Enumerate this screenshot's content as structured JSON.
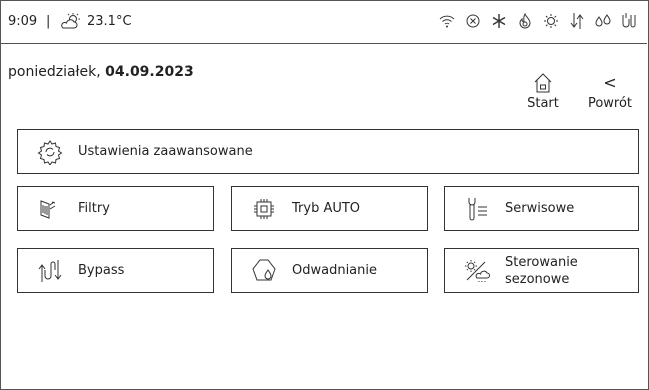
{
  "status": {
    "time": "9:09",
    "separator": "|",
    "temperature": "23.1°C",
    "icons": [
      "wifi-icon",
      "cancel-circle-icon",
      "snowflake-icon",
      "flame-icon",
      "sun-alert-icon",
      "airflow-icon",
      "drops-icon",
      "humidity-icon"
    ]
  },
  "date": {
    "weekday": "poniedziałek,",
    "date": "04.09.2023"
  },
  "nav": {
    "start": "Start",
    "back": "Powrót",
    "back_glyph": "<"
  },
  "buttons": {
    "advanced": "Ustawienia zaawansowane",
    "filters": "Filtry",
    "auto": "Tryb AUTO",
    "service": "Serwisowe",
    "bypass": "Bypass",
    "drainage": "Odwadnianie",
    "seasonal_1": "Sterowanie",
    "seasonal_2": "sezonowe"
  },
  "colors": {
    "border": "#333333",
    "text": "#222222",
    "background": "#ffffff"
  }
}
